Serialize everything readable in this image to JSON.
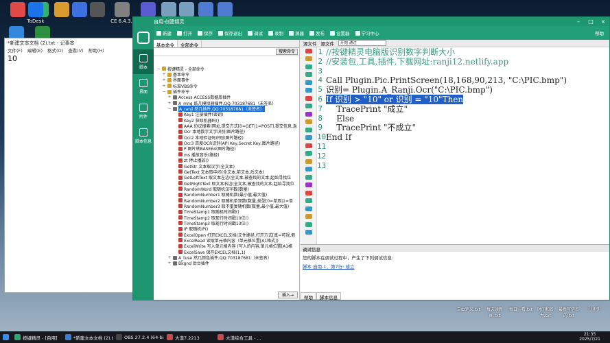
{
  "desktop_top_icons": [
    {
      "label": "",
      "color": "#e24a4a"
    },
    {
      "label": "",
      "color": "#2bb56f"
    },
    {
      "label": "",
      "color": "#d99b2e"
    },
    {
      "label": "",
      "color": "#3d6fe0"
    },
    {
      "label": "",
      "color": "#555"
    },
    {
      "label": "CE 6.4.3..",
      "color": "#808080"
    },
    {
      "label": "大漠综合工...",
      "color": "#5b5bd0"
    },
    {
      "label": "鲁人办公...",
      "color": "#7aa0c0"
    },
    {
      "label": "鼠口办公..",
      "color": "#7aa0c0"
    },
    {
      "label": "鲁人插件...",
      "color": "#4f7bd0"
    },
    {
      "label": "插件注册..",
      "color": "#4f7bd0"
    }
  ],
  "desktop_left_icons": [
    {
      "label": "",
      "color": "#3388dd"
    },
    {
      "label": "ToDesk",
      "color": "#1a73e8"
    },
    {
      "label": "",
      "color": "#2c8f3f"
    }
  ],
  "desktop_bottom_icons": [
    {
      "label": "自由定义.txt",
      "color": "#eee"
    },
    {
      "label": "每天读新闻.txt",
      "color": "#eee"
    },
    {
      "label": "每日一看.txt",
      "color": "#eee"
    },
    {
      "label": "时间和名为.txt",
      "color": "#eee"
    },
    {
      "label": "最新写信名的.txt",
      "color": "#eee"
    },
    {
      "label": "1j.jpg",
      "color": "#eee"
    }
  ],
  "notepad": {
    "title": "*新建文本文档 (2).txt - 记事本",
    "menu": [
      "文件(F)",
      "编辑(E)",
      "格式(O)",
      "查看(V)",
      "帮助(H)"
    ],
    "content": "10"
  },
  "main": {
    "title": "自用-创建精灵",
    "toolbar": [
      "新建",
      "打开",
      "保存",
      "保存退出",
      "调试",
      "录制",
      "源器",
      "发布",
      "设置器",
      "学习中心"
    ],
    "right_label": "帮助",
    "rail": [
      "脚本",
      "界面",
      "附件",
      "脚本信息"
    ],
    "cmd_tabs": [
      "基本命令",
      "全部命令"
    ],
    "search_btn": "搜索命令",
    "tree": [
      {
        "label": "按键精灵 - 全部命令",
        "lvl": 0,
        "ex": "−"
      },
      {
        "label": "基本命令",
        "lvl": 1,
        "ex": "+"
      },
      {
        "label": "界面事件",
        "lvl": 1,
        "ex": "+"
      },
      {
        "label": "标准VBS命令",
        "lvl": 1,
        "ex": "+"
      },
      {
        "label": "插件命令",
        "lvl": 1,
        "ex": "−"
      },
      {
        "label": "Access ACCESS数据库插件",
        "lvl": 2,
        "ex": "+"
      },
      {
        "label": "A_mnq 纸几模拟器插件,QQ:703187681（未签名）",
        "lvl": 2,
        "ex": "+"
      },
      {
        "label": "A_ranji 然几插件,QQ:703187681（未签名）",
        "lvl": 2,
        "ex": "−",
        "sel": true
      },
      {
        "label": "Key1 注册插件(密钥)",
        "lvl": 3,
        "ex": ""
      },
      {
        "label": "Key2 获取机器码()",
        "lvl": 3,
        "ex": ""
      },
      {
        "label": "AAA 协议搜索(网址,提交方式[0=GET|1=POST],提交信息,返",
        "lvl": 3,
        "ex": ""
      },
      {
        "label": "Ocr 本地数字文字识别(图片路径)",
        "lvl": 3,
        "ex": ""
      },
      {
        "label": "Ocr2 本地验证码识别(图片路径)",
        "lvl": 3,
        "ex": ""
      },
      {
        "label": "Ocr3 百度OCR识别(API Key,Secret Key,图片路径)",
        "lvl": 3,
        "ex": ""
      },
      {
        "label": "P 图片转BASE64(图片路径)",
        "lvl": 3,
        "ex": ""
      },
      {
        "label": "ms 播放音乐(路径)",
        "lvl": 3,
        "ex": ""
      },
      {
        "label": "zt 停止播放()",
        "lvl": 3,
        "ex": ""
      },
      {
        "label": "GetStr 文本取汉字(全文本)",
        "lvl": 3,
        "ex": ""
      },
      {
        "label": "GetText 文本取中间(全文本,前文本,后文本)",
        "lvl": 3,
        "ex": ""
      },
      {
        "label": "GetLeftText 取文本左边(全文本,被查找的文本,起始寻找位",
        "lvl": 3,
        "ex": ""
      },
      {
        "label": "GetRightText 取文本右边(全文本,被查找的文本,起始寻找位",
        "lvl": 3,
        "ex": ""
      },
      {
        "label": "RandomWord 取随机汉字数(数量)",
        "lvl": 3,
        "ex": ""
      },
      {
        "label": "RandomNumber1 取随机数(最小值,最大值)",
        "lvl": 3,
        "ex": ""
      },
      {
        "label": "RandomNumber2 取随机单双数(数量,类型[0=单双|1=单",
        "lvl": 3,
        "ex": ""
      },
      {
        "label": "RandomNumber3 取不重复随机数(数量,最小值,最大值)",
        "lvl": 3,
        "ex": ""
      },
      {
        "label": "TimeStamp1 取随机时间戳()",
        "lvl": 3,
        "ex": ""
      },
      {
        "label": "TimeStamp2 取现行时间戳10位()",
        "lvl": 3,
        "ex": ""
      },
      {
        "label": "TimeStamp3 取现行时间戳13位()",
        "lvl": 3,
        "ex": ""
      },
      {
        "label": "IP 取随机IP()",
        "lvl": 3,
        "ex": ""
      },
      {
        "label": "ExcelOpen 打开EXCEL文档(文件路径,打开方式[真=可视,假",
        "lvl": 3,
        "ex": ""
      },
      {
        "label": "ExcelRead 读取单元格内容（单元格位置[A1格式])",
        "lvl": 3,
        "ex": ""
      },
      {
        "label": "ExcelWrite 写入单元格内容 (写入的内容,单元格位置[A1格",
        "lvl": 3,
        "ex": ""
      },
      {
        "label": "ExcelSave 保存EXCEL文档(1,1)",
        "lvl": 3,
        "ex": ""
      },
      {
        "label": "A_tuse 然几颜色插件,QQ:703187681（未签名）",
        "lvl": 2,
        "ex": "+"
      },
      {
        "label": "Bkgnd 后台插件",
        "lvl": 2,
        "ex": "+"
      }
    ],
    "insert_btn": "插入→",
    "editor_tabs": [
      "源文件",
      "源文件"
    ],
    "editor_combo": "开始 通过",
    "line_numbers": [
      "1",
      "2",
      "3",
      "4",
      "5",
      "6",
      "7",
      "8",
      "9",
      "10",
      "11",
      "12",
      "13"
    ],
    "code": [
      {
        "t": "//按键精灵电脑版识别数字判断大小",
        "c": "cm"
      },
      {
        "t": "//安装包,工具,插件,下载网址:ranji12.netlify.app",
        "c": "cm"
      },
      {
        "t": "",
        "c": ""
      },
      {
        "t": "Call Plugin.Pic.PrintScreen(18,168,90,213, \"C:\\PIC.bmp\")",
        "c": ""
      },
      {
        "t": "识别= Plugin.A_Ranji.Ocr(\"C:\\PIC.bmp\")",
        "c": ""
      },
      {
        "t": "If 识别 > \"10\" or 识别 = \"10\"Then",
        "c": "hl"
      },
      {
        "t": "    TracePrint \"成立\"",
        "c": ""
      },
      {
        "t": "    Else",
        "c": ""
      },
      {
        "t": "    TracePrint \"不成立\"",
        "c": ""
      },
      {
        "t": "End If",
        "c": ""
      },
      {
        "t": "",
        "c": ""
      },
      {
        "t": "",
        "c": ""
      },
      {
        "t": "",
        "c": ""
      }
    ],
    "info_header": "调试信息",
    "info_msg": "您的脚本在调试过程中，产生了下列调试信息:",
    "info_link": "脚本 自用-1，第7行: 成立",
    "info_tabs": [
      "帮助",
      "脚本信息"
    ]
  },
  "taskbar": {
    "tasks": [
      {
        "label": "按键精灵 - [自用]",
        "color": "#2aa870"
      },
      {
        "label": "*新建文本文档 (2).t...",
        "color": "#3c7bd6"
      },
      {
        "label": "OBS 27.2.4 (64-bi...",
        "color": "#444"
      },
      {
        "label": "大漠7.2213",
        "color": "#c94a4a"
      },
      {
        "label": "大漠综合工具 - ...",
        "color": "#c94a4a"
      }
    ],
    "time": "21:35",
    "date": "2025/7/21"
  }
}
